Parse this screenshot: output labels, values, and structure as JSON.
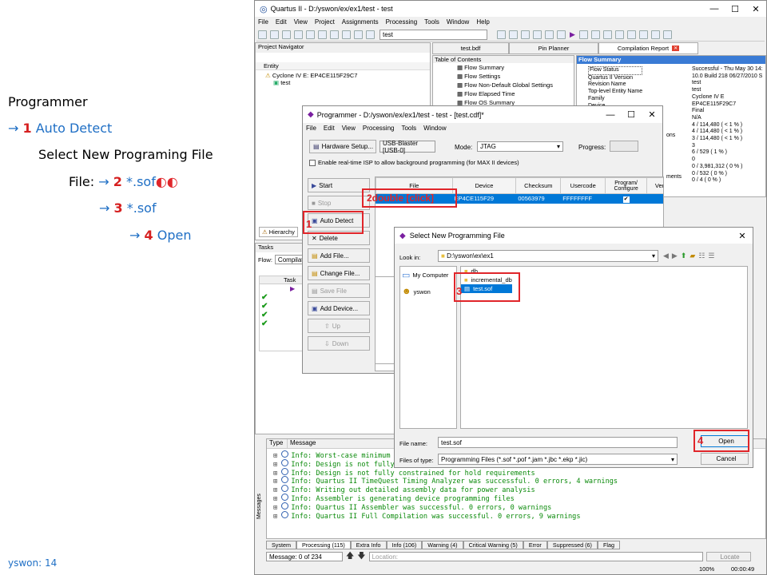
{
  "slide": {
    "line1": "Programmer",
    "line2": {
      "arrow": "→ ",
      "num": "1",
      "text": " Auto Detect"
    },
    "line3": "Select New Programing File",
    "line4": {
      "lead": "File: ",
      "arrow": "→ ",
      "num": "2",
      "text": " *.sof",
      "mark": "◐◐"
    },
    "line5": {
      "arrow": "→ ",
      "num": "3",
      "text": " *.sof"
    },
    "line6": {
      "arrow": "→ ",
      "num": "4",
      "text": " Open"
    },
    "footer": "yswon: 14",
    "page_num": "14"
  },
  "quartus": {
    "title": "Quartus II - D:/yswon/ex/ex1/test - test",
    "menu": [
      "File",
      "Edit",
      "View",
      "Project",
      "Assignments",
      "Processing",
      "Tools",
      "Window",
      "Help"
    ],
    "project_select": "test",
    "project_navigator": "Project Navigator",
    "entity_header": "Entity",
    "device": "Cyclone IV E: EP4CE115F29C7",
    "entity": "test",
    "hierarchy_tab": "Hierarchy",
    "tabs": [
      "test.bdf",
      "Pin Planner",
      "Compilation Report"
    ],
    "toc_title": "Table of Contents",
    "toc": [
      "Flow Summary",
      "Flow Settings",
      "Flow Non-Default Global Settings",
      "Flow Elapsed Time",
      "Flow OS Summary"
    ],
    "flow_summary_title": "Flow Summary",
    "flow_labels": [
      "Flow Status",
      "Quartus II Version",
      "Revision Name",
      "Top-level Entity Name",
      "Family",
      "Device"
    ],
    "flow_values": [
      "Successful - Thu May 30 14:",
      "10.0 Build 218 06/27/2010 S",
      "test",
      "test",
      "Cyclone IV E",
      "EP4CE115F29C7",
      "Final",
      "N/A",
      "4 / 114,480 ( < 1 % )",
      "4 / 114,480 ( < 1 % )",
      "3 / 114,480 ( < 1 % )",
      "3",
      "6 / 529 ( 1 % )",
      "0",
      "0 / 3,981,312 ( 0 % )",
      "0 / 532 ( 0 % )",
      "0 / 4 ( 0 % )"
    ],
    "flow_label_frags": [
      "ons",
      "ments"
    ],
    "tasks_title": "Tasks",
    "flow_label": "Flow:",
    "flow_select": "Compilation",
    "task_header": "Task",
    "messages": [
      "Info: Worst-case minimum",
      "Info: Design is not fully",
      "Info: Design is not fully constrained for hold requirements",
      "Info: Quartus II TimeQuest Timing Analyzer was successful. 0 errors, 4 warnings",
      "Info: Writing out detailed assembly data for power analysis",
      "Info: Assembler is generating device programming files",
      "Info: Quartus II Assembler was successful. 0 errors, 0 warnings",
      "Info: Quartus II Full Compilation was successful. 0 errors, 9 warnings"
    ],
    "msg_cols": [
      "Type",
      "Message"
    ],
    "msg_tabs": [
      "System",
      "Processing (115)",
      "Extra Info",
      "Info (106)",
      "Warning (4)",
      "Critical Warning (5)",
      "Error",
      "Suppressed (6)",
      "Flag"
    ],
    "msg_count": "Message: 0 of 234",
    "location_placeholder": "Location:",
    "locate_btn": "Locate",
    "zoom": "100%",
    "elapsed": "00:00:49",
    "side_label": "Messages"
  },
  "programmer": {
    "title": "Programmer - D:/yswon/ex/ex1/test - test - [test.cdf]*",
    "menu": [
      "File",
      "Edit",
      "View",
      "Processing",
      "Tools",
      "Window"
    ],
    "hardware_btn": "Hardware Setup...",
    "hardware_value": "USB-Blaster [USB-0]",
    "mode_label": "Mode:",
    "mode_value": "JTAG",
    "progress_label": "Progress:",
    "isp_text": "Enable real-time ISP to allow background programming (for MAX II devices)",
    "buttons": [
      "Start",
      "Stop",
      "Auto Detect",
      "Delete",
      "Add File...",
      "Change File...",
      "Save File",
      "Add Device...",
      "Up",
      "Down"
    ],
    "table_headers": [
      "File",
      "Device",
      "Checksum",
      "Usercode",
      "Program/ Configure",
      "Ver"
    ],
    "row": {
      "file": "",
      "device": "EP4CE115F29",
      "checksum": "00563979",
      "usercode": "FFFFFFFF"
    },
    "dbl_click": "2double [click]",
    "num1": "1"
  },
  "file_dialog": {
    "title": "Select New Programming File",
    "look_in_label": "Look in:",
    "look_in": "D:\\yswon\\ex\\ex1",
    "places": [
      "My Computer",
      "yswon"
    ],
    "files": [
      "db",
      "incremental_db",
      "test.sof"
    ],
    "file_name_label": "File name:",
    "file_name": "test.sof",
    "type_label": "Files of type:",
    "type_value": "Programming Files (*.sof *.pof *.jam *.jbc *.ekp *.jic)",
    "open_btn": "Open",
    "cancel_btn": "Cancel",
    "num3": "3",
    "num4": "4"
  },
  "colors": {
    "accent": "#1f6fc5",
    "red": "#e0252a",
    "select": "#0078d7",
    "green": "#0a8a0a"
  }
}
